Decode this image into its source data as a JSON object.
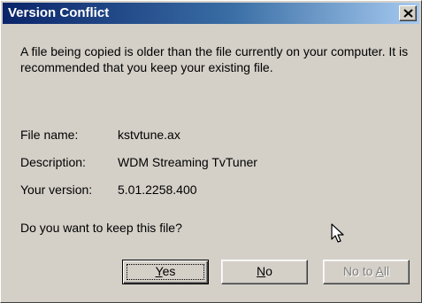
{
  "window": {
    "title": "Version Conflict"
  },
  "message": "A file being copied is older than the file currently on your computer. It is recommended that you keep your existing file.",
  "fields": {
    "file_name_label": "File name:",
    "file_name_value": "kstvtune.ax",
    "description_label": "Description:",
    "description_value": "WDM Streaming TvTuner",
    "version_label": "Your version:",
    "version_value": "5.01.2258.400"
  },
  "question": "Do you want to keep this file?",
  "buttons": {
    "yes": {
      "prefix": "",
      "mnemonic": "Y",
      "suffix": "es"
    },
    "no": {
      "prefix": "",
      "mnemonic": "N",
      "suffix": "o"
    },
    "no_to_all": {
      "prefix": "No to ",
      "mnemonic": "A",
      "suffix": "ll",
      "disabled": true
    }
  },
  "icons": {
    "close": "close-icon",
    "cursor": "mouse-pointer-icon"
  },
  "colors": {
    "title_start": "#0a246a",
    "title_end": "#a6caf0",
    "face": "#d4d0c8"
  }
}
